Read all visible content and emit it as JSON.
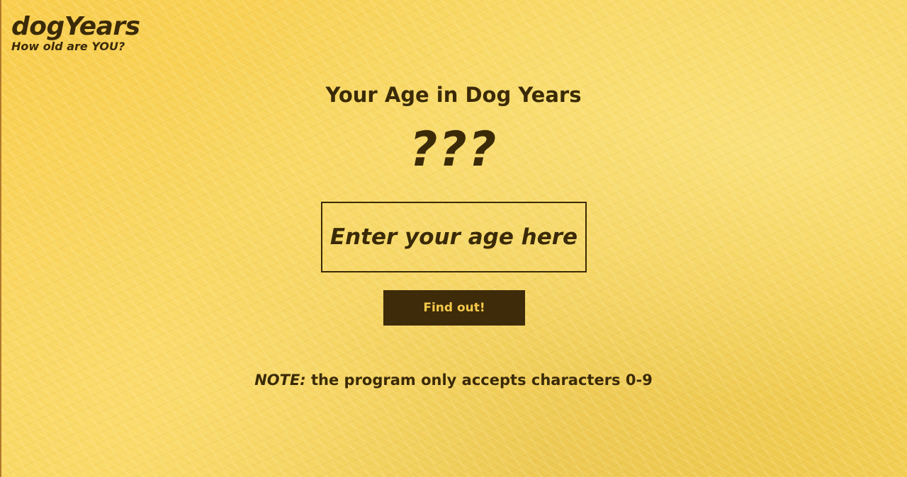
{
  "brand": {
    "title": "dogYears",
    "tagline": "How old are YOU?"
  },
  "main": {
    "heading": "Your Age in Dog Years",
    "result": "???",
    "age_input": {
      "value": "",
      "placeholder": "Enter your age here"
    },
    "find_button_label": "Find out!",
    "note": {
      "label": "NOTE:",
      "text": " the program only accepts characters 0-9"
    }
  },
  "colors": {
    "background": "#f7c94a",
    "text": "#3a2a08",
    "button_bg": "#3d2b0a",
    "button_text": "#f7c94a"
  }
}
